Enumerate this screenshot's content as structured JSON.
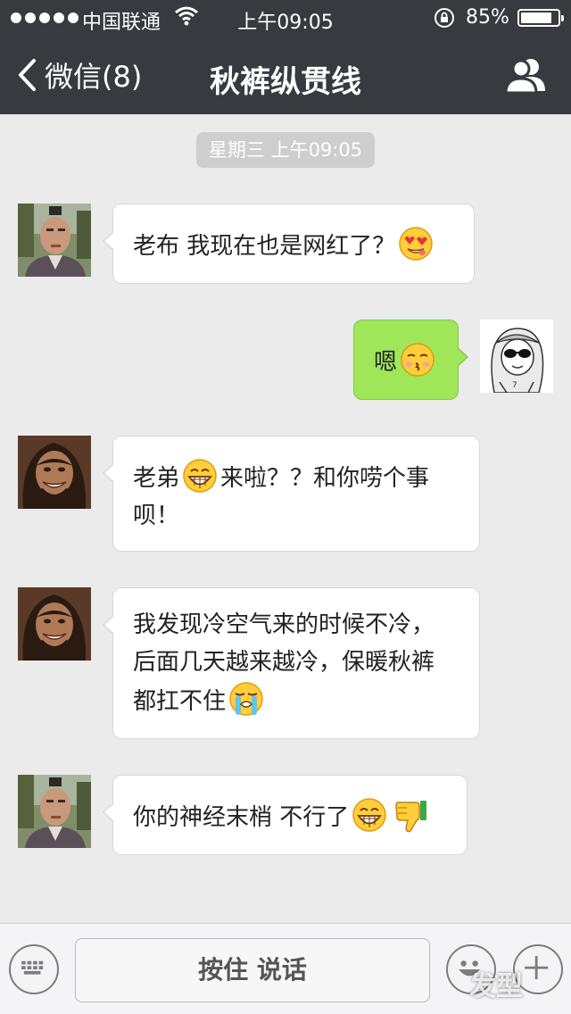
{
  "status_bar": {
    "carrier": "中国联通",
    "time": "上午09:05",
    "battery": "85%",
    "battery_level": 0.85
  },
  "nav": {
    "back_label": "微信(8)",
    "title": "秋裤纵贯线"
  },
  "chat": {
    "timestamp": "星期三 上午09:05",
    "messages": [
      {
        "side": "left",
        "avatar": "bald-man-avatar",
        "text": "老布 我现在也是网红了？",
        "emojis": [
          "heart-eyes-emoji"
        ]
      },
      {
        "side": "right",
        "avatar": "cartoon-sunglasses-avatar",
        "text": "嗯",
        "emojis": [
          "kiss-emoji"
        ]
      },
      {
        "side": "left",
        "avatar": "longhair-man-avatar",
        "text_a": "老弟",
        "text_b": "来啦？？和你唠个事",
        "text_c": "呗！",
        "emojis": [
          "grin-emoji"
        ]
      },
      {
        "side": "left",
        "avatar": "longhair-man-avatar",
        "line1": "我发现冷空气来的时候不冷，",
        "line2": "后面几天越来越冷，保暖秋裤",
        "line3": "都扛不住",
        "emojis": [
          "crying-emoji"
        ]
      },
      {
        "side": "left",
        "avatar": "bald-man-avatar",
        "text": "你的神经末梢 不行了",
        "emojis": [
          "grin-emoji",
          "thumbs-down-emoji"
        ]
      }
    ]
  },
  "input_bar": {
    "talk_label": "按住 说话"
  },
  "watermark": "发型"
}
